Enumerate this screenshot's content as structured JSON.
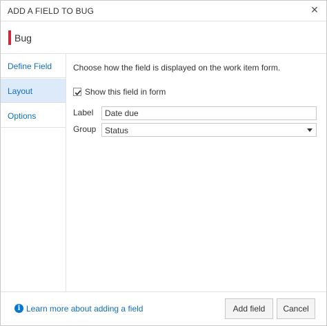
{
  "dialog": {
    "title": "ADD A FIELD TO BUG",
    "close_icon": "close-icon"
  },
  "work_item": {
    "name": "Bug",
    "color": "#cc293d"
  },
  "nav": {
    "items": [
      {
        "label": "Define Field",
        "selected": false
      },
      {
        "label": "Layout",
        "selected": true
      },
      {
        "label": "Options",
        "selected": false
      }
    ]
  },
  "layout": {
    "description": "Choose how the field is displayed on the work item form.",
    "show_in_form": {
      "label": "Show this field in form",
      "checked": true
    },
    "label_field": {
      "label": "Label",
      "value": "Date due"
    },
    "group_field": {
      "label": "Group",
      "value": "Status"
    }
  },
  "footer": {
    "help_text": "Learn more about adding a field",
    "help_icon": "info-icon",
    "add_button": "Add field",
    "cancel_button": "Cancel"
  },
  "colors": {
    "accent": "#0078d4",
    "link": "#106ebe",
    "selected_nav_bg": "#dceaf9"
  }
}
